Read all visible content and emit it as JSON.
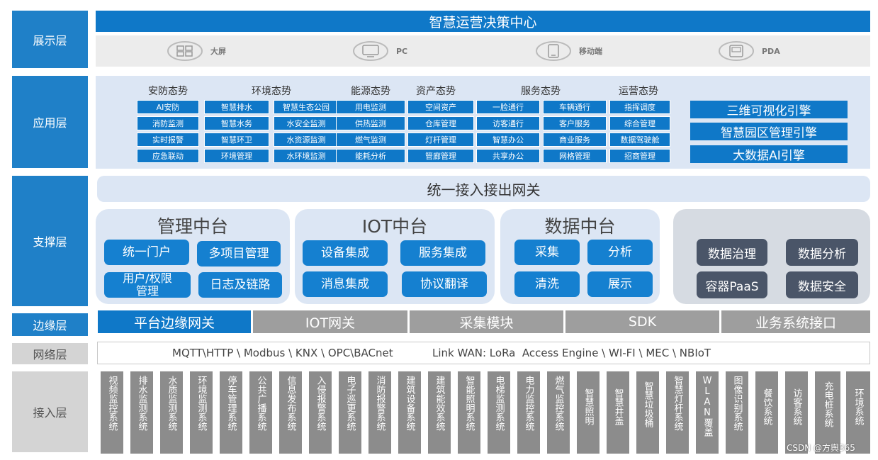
{
  "layers": {
    "display": "展示层",
    "application": "应用层",
    "support": "支撑层",
    "edge": "边缘层",
    "network": "网络层",
    "access": "接入层"
  },
  "display": {
    "title": "智慧运营决策中心",
    "terminals": [
      {
        "icon": "big-screen-icon",
        "label": "大屏"
      },
      {
        "icon": "pc-icon",
        "label": "PC"
      },
      {
        "icon": "mobile-icon",
        "label": "移动端"
      },
      {
        "icon": "pda-icon",
        "label": "PDA"
      }
    ]
  },
  "application": {
    "categories": [
      "安防态势",
      "环境态势",
      "能源态势",
      "资产态势",
      "服务态势",
      "运营态势"
    ],
    "columns": [
      [
        "AI安防",
        "消防监测",
        "实时报警",
        "应急联动"
      ],
      [
        "智慧排水",
        "智慧水务",
        "智慧环卫",
        "环境管理"
      ],
      [
        "智慧生态公园",
        "水安全监测",
        "水资源监测",
        "水环境监测"
      ],
      [
        "用电监测",
        "供热监测",
        "燃气监测",
        "能耗分析"
      ],
      [
        "空间资产",
        "仓库管理",
        "灯杆管理",
        "管廊管理"
      ],
      [
        "一脸通行",
        "访客通行",
        "智慧办公",
        "共享办公"
      ],
      [
        "车辆通行",
        "客户服务",
        "商业服务",
        "网格管理"
      ],
      [
        "指挥调度",
        "综合管理",
        "数据驾驶舱",
        "招商管理"
      ]
    ],
    "engines": [
      "三维可视化引擎",
      "智慧园区管理引擎",
      "大数据AI引擎"
    ]
  },
  "support": {
    "gateway": "统一接入接出网关",
    "management": {
      "title": "管理中台",
      "items": [
        "统一门户",
        "多项目管理",
        "用户/权限\n管理",
        "日志及链路"
      ]
    },
    "iot": {
      "title": "IOT中台",
      "items": [
        "设备集成",
        "服务集成",
        "消息集成",
        "协议翻译"
      ]
    },
    "data": {
      "title": "数据中台",
      "items": [
        "采集",
        "分析",
        "清洗",
        "展示"
      ]
    },
    "services": [
      "数据治理",
      "数据分析",
      "容器PaaS",
      "数据安全"
    ]
  },
  "edge": {
    "items": [
      "平台边缘网关",
      "IOT网关",
      "采集模块",
      "SDK",
      "业务系统接口"
    ],
    "colors": {
      "active": "#0f78c8",
      "inactive": "#9e9e9e"
    }
  },
  "network": {
    "left": "MQTT\\HTTP \\ Modbus \\ KNX \\ OPC\\BACnet",
    "right": "Link WAN: LoRa  Access Engine \\ WI-FI \\ MEC \\ NBIoT"
  },
  "access": {
    "systems": [
      "视频监控系统",
      "排水监测系统",
      "水质监测系统",
      "环境监测系统",
      "停车管理系统",
      "公共广播系统",
      "信息发布系统",
      "入侵报警系统",
      "电子巡更系统",
      "消防报警系统",
      "建筑设备系统",
      "建筑能效系统",
      "智能照明系统",
      "电梯监测系统",
      "电力监控系统",
      "燃气监控系统",
      "智慧照明",
      "智慧井盖",
      "智慧垃圾桶",
      "智慧灯杆系统",
      "WLAN覆盖",
      "图像识别系统",
      "餐饮系统",
      "访客系统",
      "充电桩系统",
      "环境系统"
    ]
  },
  "watermark": "CSDN @方舆365"
}
